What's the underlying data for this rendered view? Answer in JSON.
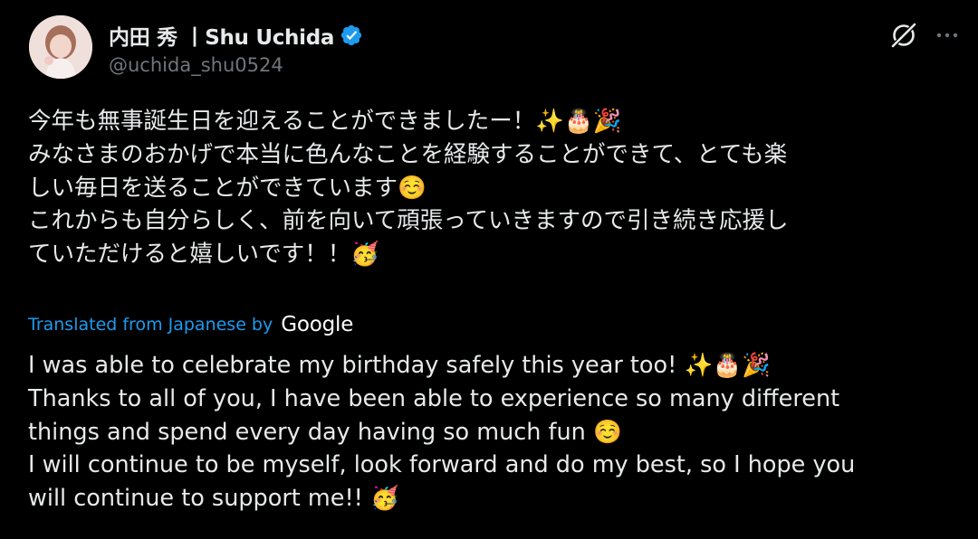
{
  "author": {
    "display_name": "内田 秀 丨Shu Uchida",
    "handle": "@uchida_shu0524",
    "verified": true,
    "badge_color": "#1d9bf0"
  },
  "header_actions": {
    "grok_icon": "grok-icon",
    "more_icon": "more-icon"
  },
  "tweet": {
    "lines": [
      "今年も無事誕生日を迎えることができましたー！✨🎂🎉",
      "みなさまのおかげで本当に色んなことを経験することができて、とても楽",
      "しい毎日を送ることができています☺️",
      "これからも自分らしく、前を向いて頑張っていきますので引き続き応援し",
      "ていただけると嬉しいです！！🥳"
    ]
  },
  "translation": {
    "label": "Translated from Japanese by",
    "provider": "Google",
    "lines": [
      "I was able to celebrate my birthday safely this year too! ✨🎂🎉",
      "Thanks to all of you, I have been able to experience so many different",
      "things and spend every day having so much fun ☺️",
      "I will continue to be myself, look forward and do my best, so I hope you",
      "will continue to support me!! 🥳"
    ]
  },
  "colors": {
    "background": "#000000",
    "text": "#e7e9ea",
    "secondary": "#71767b",
    "link": "#1d9bf0"
  }
}
